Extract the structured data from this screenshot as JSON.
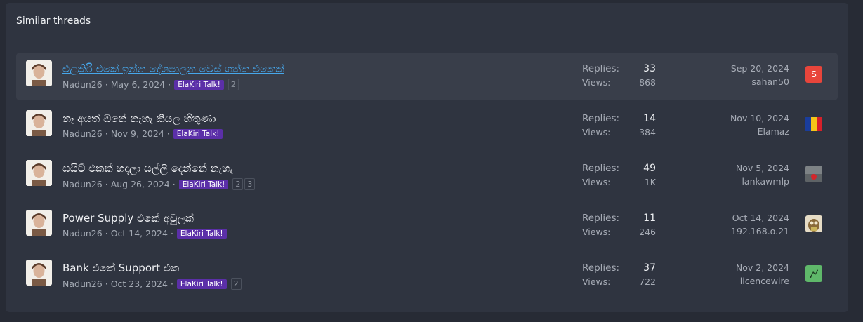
{
  "block": {
    "title": "Similar threads"
  },
  "labels": {
    "replies": "Replies:",
    "views": "Views:"
  },
  "threads": [
    {
      "title": "එළකිරි එකේ ඉන්න දේශපාලන වෙස් ගත්ත එකෙක්",
      "author": "Nadun26",
      "date": "May 6, 2024",
      "prefix": "ElaKiri Talk!",
      "pages": [
        "2"
      ],
      "replies": "33",
      "views": "868",
      "last_date": "Sep 20, 2024",
      "last_user": "sahan50",
      "last_avatar_letter": "S"
    },
    {
      "title": "නෑ අයත් ඕනේ නැහැ කියල හිතුණා",
      "author": "Nadun26",
      "date": "Nov 9, 2024",
      "prefix": "ElaKiri Talk!",
      "pages": [],
      "replies": "14",
      "views": "384",
      "last_date": "Nov 10, 2024",
      "last_user": "Elamaz"
    },
    {
      "title": "සයිට් එකක් හදලා සල්ලි දෙන්නේ නැහැ",
      "author": "Nadun26",
      "date": "Aug 26, 2024",
      "prefix": "ElaKiri Talk!",
      "pages": [
        "2",
        "3"
      ],
      "replies": "49",
      "views": "1K",
      "last_date": "Nov 5, 2024",
      "last_user": "lankawmlp"
    },
    {
      "title": "Power Supply එකේ අවුලක්",
      "author": "Nadun26",
      "date": "Oct 14, 2024",
      "prefix": "ElaKiri Talk!",
      "pages": [],
      "replies": "11",
      "views": "246",
      "last_date": "Oct 14, 2024",
      "last_user": "192.168.o.21"
    },
    {
      "title": "Bank එකේ Support එක",
      "author": "Nadun26",
      "date": "Oct 23, 2024",
      "prefix": "ElaKiri Talk!",
      "pages": [
        "2"
      ],
      "replies": "37",
      "views": "722",
      "last_date": "Nov 2, 2024",
      "last_user": "licencewire"
    }
  ],
  "colors": {
    "link": "#47a7eb",
    "prefix_bg": "#5b2fa8",
    "panel": "#2f3440"
  }
}
